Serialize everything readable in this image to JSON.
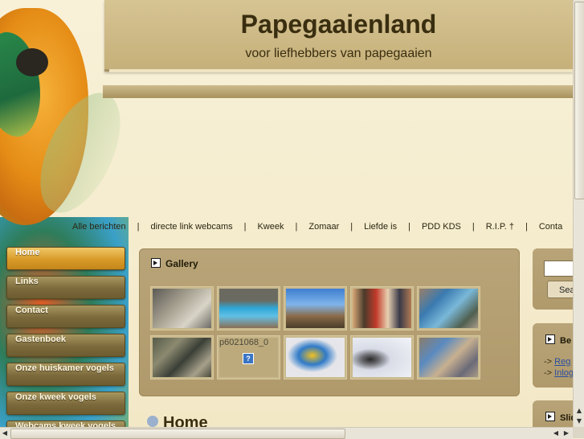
{
  "site": {
    "title": "Papegaaienland",
    "subtitle": "voor liefhebbers van papegaaien"
  },
  "topnav": [
    "Alle berichten",
    "directe link webcams",
    "Kweek",
    "Zomaar",
    "Liefde is",
    "PDD KDS",
    "R.I.P. †",
    "Conta"
  ],
  "topnav_separator": "|",
  "leftmenu": [
    {
      "label": "Home",
      "active": true
    },
    {
      "label": "Links",
      "active": false
    },
    {
      "label": "Contact",
      "active": false
    },
    {
      "label": "Gastenboek",
      "active": false
    },
    {
      "label": "Onze huiskamer vogels",
      "active": false
    },
    {
      "label": "Onze kweek vogels",
      "active": false
    },
    {
      "label": "Webcams kweek vogels",
      "active": false
    }
  ],
  "gallery": {
    "title": "Gallery",
    "broken_filename": "p6021068_0",
    "broken_icon": "?"
  },
  "main": {
    "heading": "Home"
  },
  "search": {
    "button_label": "Search"
  },
  "sidebar_box1": {
    "heading": "Be",
    "links": [
      {
        "prefix": "->",
        "label": "Reg"
      },
      {
        "prefix": "->",
        "label": "Inlog"
      }
    ]
  },
  "sidebar_box2": {
    "heading": "Slid"
  },
  "icons": {
    "scroll_up": "▲",
    "scroll_down": "▼",
    "scroll_left": "◀",
    "scroll_right": "▶"
  }
}
